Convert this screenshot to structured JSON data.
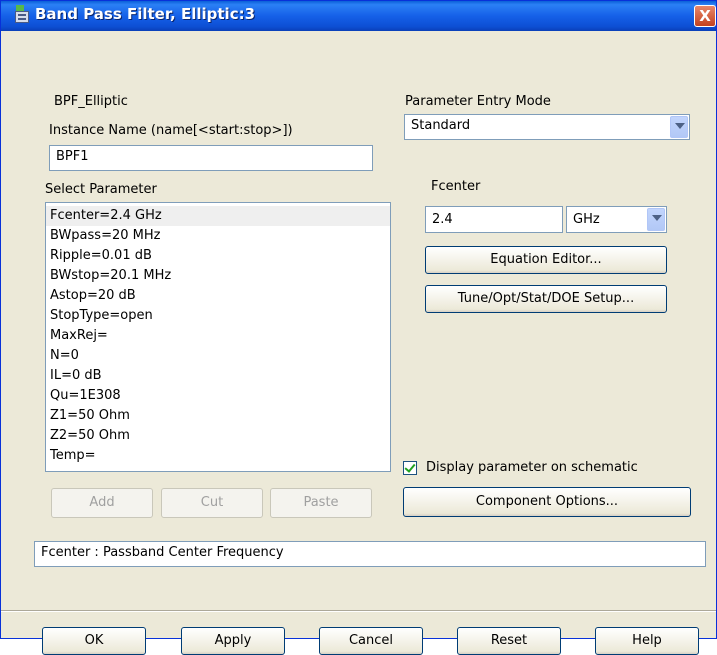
{
  "window": {
    "title": "Band Pass Filter, Elliptic:3",
    "close_label": "X"
  },
  "component_name": "BPF_Elliptic",
  "instance": {
    "label": "Instance Name  (name[<start:stop>])",
    "value": "BPF1"
  },
  "select_parameter": {
    "label": "Select Parameter",
    "items": [
      "Fcenter=2.4 GHz",
      "BWpass=20 MHz",
      "Ripple=0.01 dB",
      "BWstop=20.1 MHz",
      "Astop=20 dB",
      "StopType=open",
      "MaxRej=",
      "N=0",
      "IL=0 dB",
      "Qu=1E308",
      "Z1=50 Ohm",
      "Z2=50 Ohm",
      "Temp="
    ],
    "selected": "Fcenter=2.4 GHz"
  },
  "list_buttons": {
    "add": "Add",
    "cut": "Cut",
    "paste": "Paste"
  },
  "entry_mode": {
    "label": "Parameter Entry Mode",
    "value": "Standard"
  },
  "param": {
    "name": "Fcenter",
    "value": "2.4",
    "unit": "GHz",
    "equation_editor": "Equation Editor...",
    "tune_setup": "Tune/Opt/Stat/DOE Setup..."
  },
  "display_on_schematic": {
    "label": "Display parameter on schematic",
    "checked": true
  },
  "component_options": "Component Options...",
  "description": "Fcenter : Passband Center Frequency",
  "footer": {
    "ok": "OK",
    "apply": "Apply",
    "cancel": "Cancel",
    "reset": "Reset",
    "help": "Help"
  },
  "colors": {
    "titlebar": "#0d4fd4",
    "dialog_bg": "#ece9d8",
    "close": "#c4421f",
    "check": "#21a121"
  }
}
